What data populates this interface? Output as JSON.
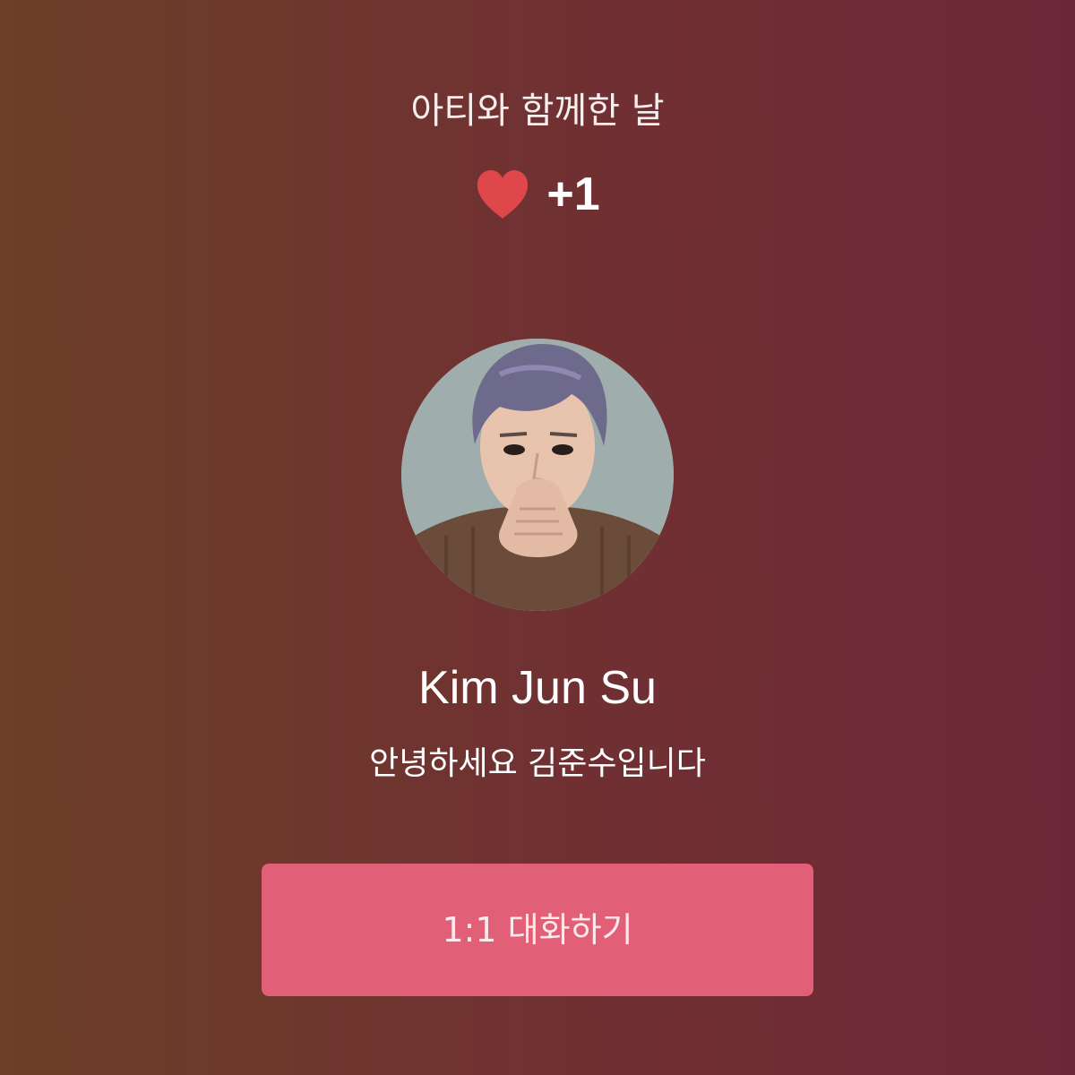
{
  "header": {
    "title": "아티와 함께한 날"
  },
  "affinity": {
    "icon": "heart-icon",
    "icon_color": "#e0474a",
    "count": "+1"
  },
  "profile": {
    "avatar": "profile-photo",
    "name": "Kim Jun Su",
    "greeting": "안녕하세요 김준수입니다"
  },
  "actions": {
    "chat_label": "1:1 대화하기",
    "chat_color": "#e15f77"
  },
  "colors": {
    "background_left": "#6c3f27",
    "background_right": "#6e2737"
  }
}
